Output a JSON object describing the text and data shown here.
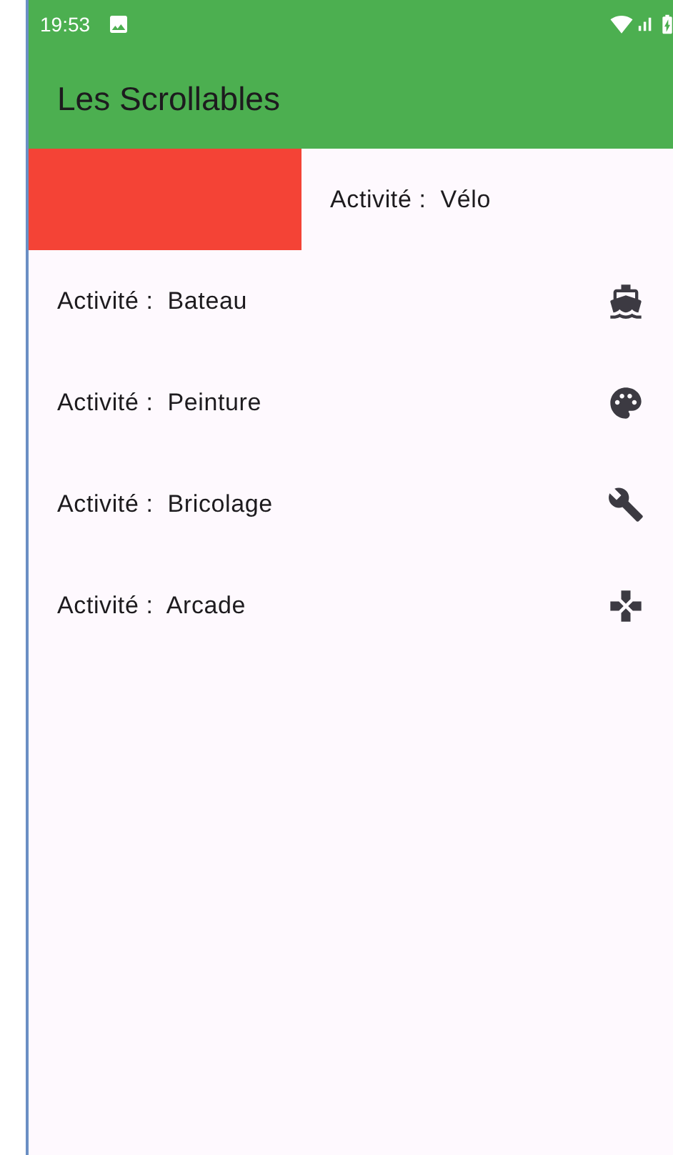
{
  "status_bar": {
    "time": "19:53"
  },
  "app_bar": {
    "title": "Les Scrollables"
  },
  "rows": [
    {
      "text": "Activité :  Vélo",
      "swiped": true
    },
    {
      "text": "Activité :  Bateau",
      "swiped": false
    },
    {
      "text": "Activité :  Peinture",
      "swiped": false
    },
    {
      "text": "Activité :  Bricolage",
      "swiped": false
    },
    {
      "text": "Activité :  Arcade",
      "swiped": false
    }
  ]
}
